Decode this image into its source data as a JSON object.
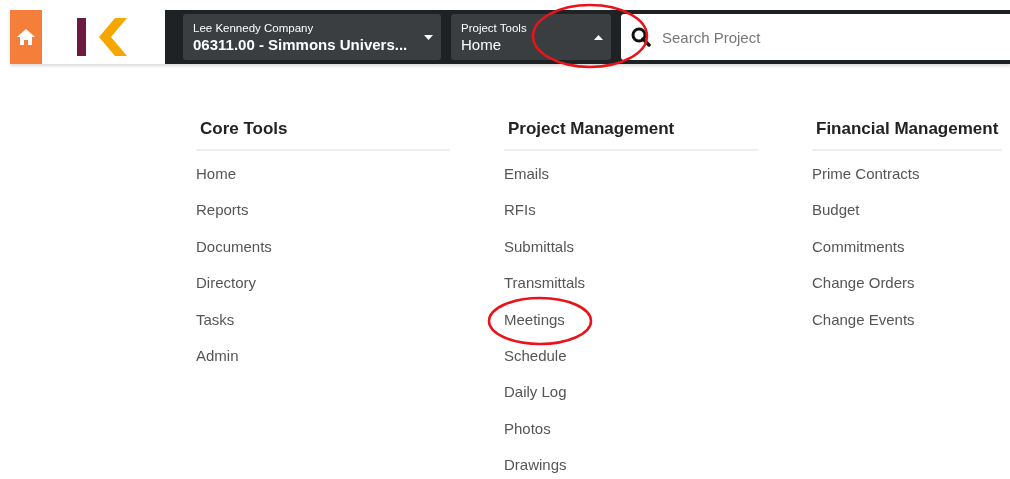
{
  "header": {
    "company": "Lee Kennedy Company",
    "project": "06311.00 - Simmons Univers...",
    "tools_label": "Project Tools",
    "tools_value": "Home",
    "search": {
      "placeholder": "Search Project"
    }
  },
  "menu": [
    {
      "title": "Core Tools",
      "items": [
        "Home",
        "Reports",
        "Documents",
        "Directory",
        "Tasks",
        "Admin"
      ]
    },
    {
      "title": "Project Management",
      "items": [
        "Emails",
        "RFIs",
        "Submittals",
        "Transmittals",
        "Meetings",
        "Schedule",
        "Daily Log",
        "Photos",
        "Drawings"
      ]
    },
    {
      "title": "Financial Management",
      "items": [
        "Prime Contracts",
        "Budget",
        "Commitments",
        "Change Orders",
        "Change Events"
      ]
    }
  ]
}
